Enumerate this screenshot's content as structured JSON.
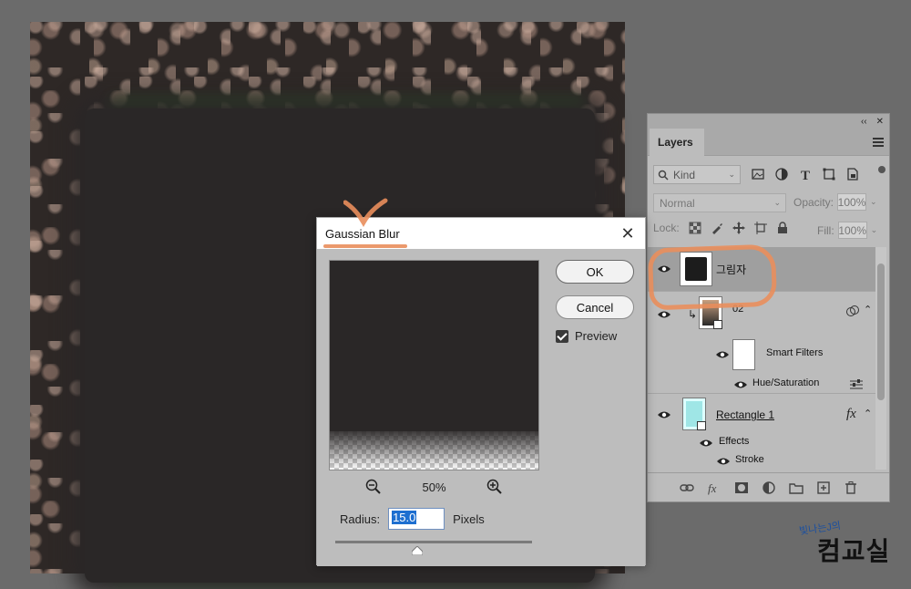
{
  "dialog": {
    "title": "Gaussian Blur",
    "ok_label": "OK",
    "cancel_label": "Cancel",
    "preview_label": "Preview",
    "preview_checked": true,
    "zoom_level": "50%",
    "radius_label": "Radius:",
    "radius_value": "15.0",
    "radius_unit": "Pixels"
  },
  "layers_panel": {
    "tab_label": "Layers",
    "filter_kind": "Kind",
    "blend_mode": "Normal",
    "opacity_label": "Opacity:",
    "opacity_value": "100%",
    "lock_label": "Lock:",
    "fill_label": "Fill:",
    "fill_value": "100%",
    "layers": [
      {
        "name": "그림자",
        "selected": true,
        "visible": true
      },
      {
        "name": "02",
        "visible": true
      },
      {
        "name": "Smart Filters",
        "visible": true
      },
      {
        "name": "Hue/Saturation",
        "visible": true
      },
      {
        "name": "Rectangle 1",
        "visible": true,
        "fx": "fx"
      },
      {
        "name": "Effects",
        "visible": true
      },
      {
        "name": "Stroke",
        "visible": true
      }
    ]
  },
  "watermark": {
    "small_text": "빛나는J의",
    "big_text": "컴교실"
  },
  "colors": {
    "annotation": "#e98e5c",
    "selection": "#1e6fd0",
    "panel_bg": "#bcbcbc"
  }
}
